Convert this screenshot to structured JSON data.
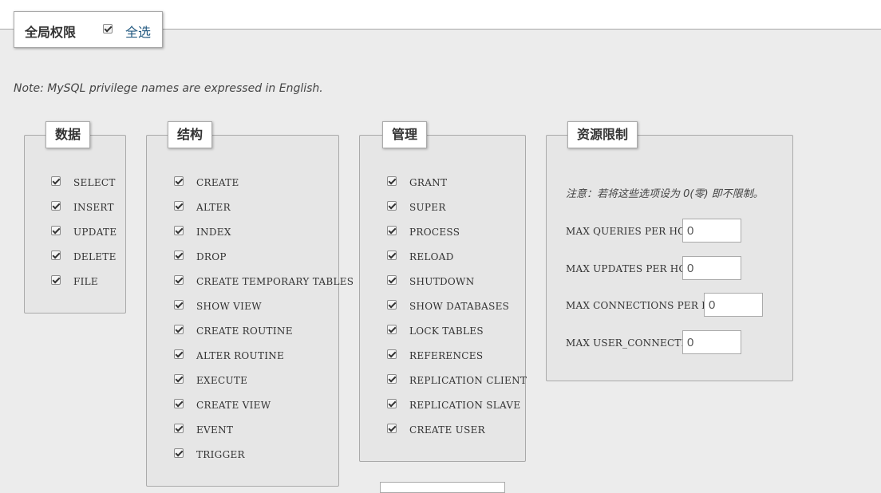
{
  "global": {
    "title": "全局权限",
    "select_all": "全选"
  },
  "note": "Note: MySQL privilege names are expressed in English.",
  "data_group": {
    "legend": "数据",
    "items": [
      "SELECT",
      "INSERT",
      "UPDATE",
      "DELETE",
      "FILE"
    ]
  },
  "structure_group": {
    "legend": "结构",
    "items": [
      "CREATE",
      "ALTER",
      "INDEX",
      "DROP",
      "CREATE TEMPORARY TABLES",
      "SHOW VIEW",
      "CREATE ROUTINE",
      "ALTER ROUTINE",
      "EXECUTE",
      "CREATE VIEW",
      "EVENT",
      "TRIGGER"
    ]
  },
  "admin_group": {
    "legend": "管理",
    "items": [
      "GRANT",
      "SUPER",
      "PROCESS",
      "RELOAD",
      "SHUTDOWN",
      "SHOW DATABASES",
      "LOCK TABLES",
      "REFERENCES",
      "REPLICATION CLIENT",
      "REPLICATION SLAVE",
      "CREATE USER"
    ]
  },
  "resource_group": {
    "legend": "资源限制",
    "note": "注意：若将这些选项设为 0(零) 即不限制。",
    "rows": [
      {
        "label": "MAX QUERIES PER HOUR",
        "value": "0"
      },
      {
        "label": "MAX UPDATES PER HOUR",
        "value": "0"
      },
      {
        "label": "MAX CONNECTIONS PER HOUR",
        "value": "0"
      },
      {
        "label": "MAX USER_CONNECTIONS",
        "value": "0"
      }
    ]
  }
}
